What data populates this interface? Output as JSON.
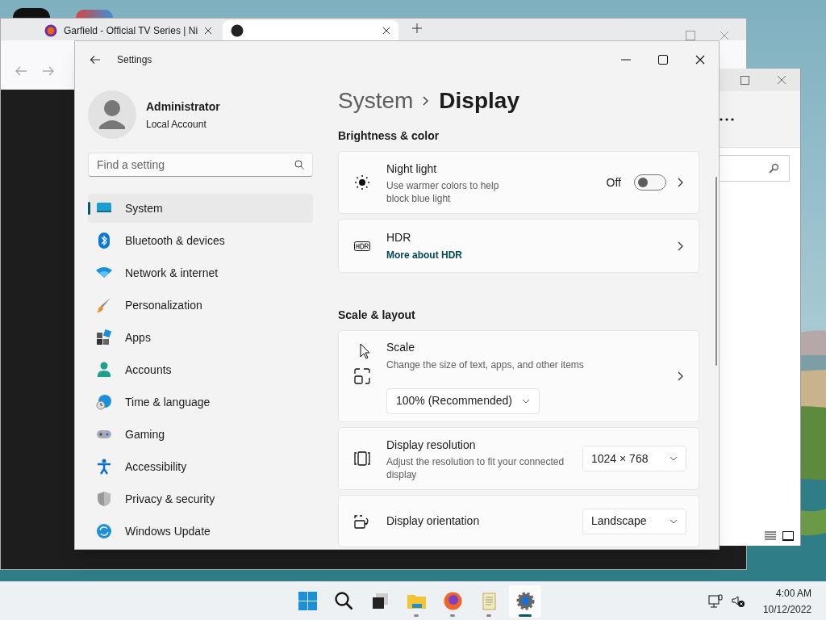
{
  "browser": {
    "tabs": [
      {
        "title": "Garfield - Official TV Series | Ni",
        "selected": false
      },
      {
        "selected": true
      }
    ]
  },
  "settings": {
    "title": "Settings",
    "account": {
      "name": "Administrator",
      "type": "Local Account"
    },
    "search": {
      "placeholder": "Find a setting"
    },
    "nav": [
      {
        "label": "System",
        "selected": true
      },
      {
        "label": "Bluetooth & devices",
        "selected": false
      },
      {
        "label": "Network & internet",
        "selected": false
      },
      {
        "label": "Personalization",
        "selected": false
      },
      {
        "label": "Apps",
        "selected": false
      },
      {
        "label": "Accounts",
        "selected": false
      },
      {
        "label": "Time & language",
        "selected": false
      },
      {
        "label": "Gaming",
        "selected": false
      },
      {
        "label": "Accessibility",
        "selected": false
      },
      {
        "label": "Privacy & security",
        "selected": false
      },
      {
        "label": "Windows Update",
        "selected": false
      }
    ],
    "breadcrumb": [
      "System",
      "Display"
    ],
    "sections": [
      {
        "heading": "Brightness & color",
        "items": [
          {
            "kind": "toggle",
            "title": "Night light",
            "description": "Use warmer colors to help block blue light",
            "state_label": "Off",
            "on": false
          },
          {
            "kind": "link",
            "title": "HDR",
            "link": "More about HDR"
          }
        ]
      },
      {
        "heading": "Scale & layout",
        "items": [
          {
            "kind": "select-below",
            "title": "Scale",
            "description": "Change the size of text, apps, and other items",
            "value": "100% (Recommended)"
          },
          {
            "kind": "select",
            "title": "Display resolution",
            "description": "Adjust the resolution to fit your connected display",
            "value": "1024 × 768"
          },
          {
            "kind": "select",
            "title": "Display orientation",
            "value": "Landscape"
          }
        ]
      }
    ]
  },
  "taskbar": {
    "apps": [
      {
        "running": false,
        "selected": false
      },
      {
        "running": false,
        "selected": false
      },
      {
        "running": false,
        "selected": false
      },
      {
        "running": true,
        "selected": false
      },
      {
        "running": true,
        "selected": false
      },
      {
        "running": true,
        "selected": false
      },
      {
        "running": true,
        "selected": true
      }
    ],
    "clock": {
      "time": "4:00 AM",
      "date": "10/12/2022"
    }
  }
}
